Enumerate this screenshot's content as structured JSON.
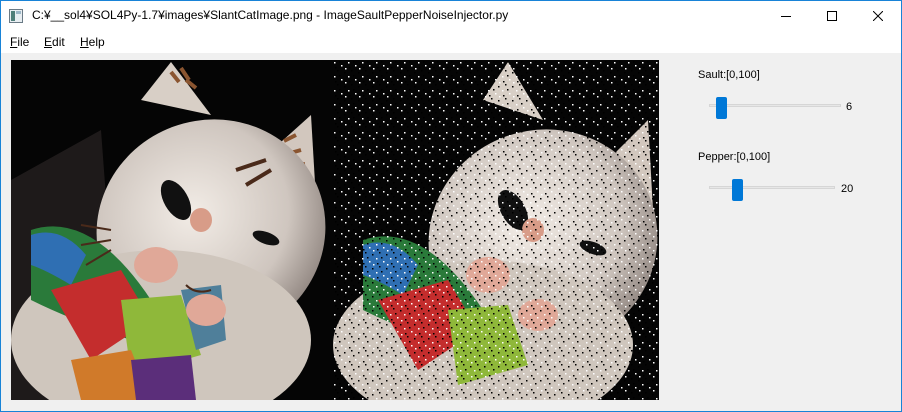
{
  "window": {
    "title": "C:¥__sol4¥SOL4Py-1.7¥images¥SlantCatImage.png - ImageSaultPepperNoiseInjector.py"
  },
  "menu": {
    "file": "ile",
    "file_mnemonic": "F",
    "edit": "dit",
    "edit_mnemonic": "E",
    "help": "elp",
    "help_mnemonic": "H"
  },
  "images": {
    "original": "cat-figurine-image",
    "noisy": "cat-figurine-noisy-image"
  },
  "controls": {
    "sault": {
      "label": "Sault:[0,100]",
      "value": "6",
      "fraction": 0.06
    },
    "pepper": {
      "label": "Pepper:[0,100]",
      "value": "20",
      "fraction": 0.2
    }
  },
  "colors": {
    "accent": "#0078d7",
    "frame": "#1883d7"
  }
}
